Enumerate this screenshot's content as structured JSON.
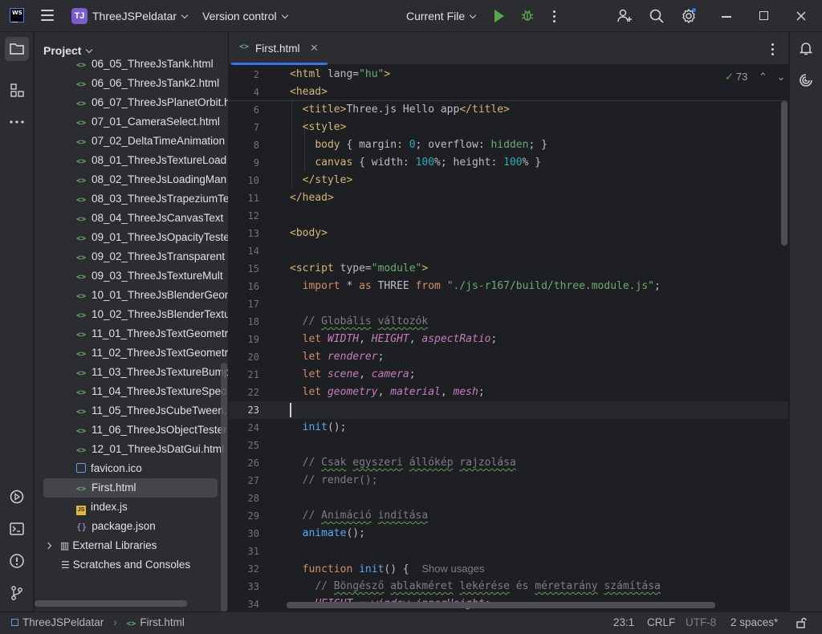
{
  "titlebar": {
    "project_badge": "TJ",
    "project_name": "ThreeJSPeldatar",
    "vcs_label": "Version control",
    "run_config": "Current File"
  },
  "project_panel": {
    "title": "Project",
    "items": [
      {
        "label": "06_05_ThreeJsTank.html",
        "type": "html"
      },
      {
        "label": "06_06_ThreeJsTank2.html",
        "type": "html"
      },
      {
        "label": "06_07_ThreeJsPlanetOrbit.h",
        "type": "html"
      },
      {
        "label": "07_01_CameraSelect.html",
        "type": "html"
      },
      {
        "label": "07_02_DeltaTimeAnimation",
        "type": "html"
      },
      {
        "label": "08_01_ThreeJsTextureLoad",
        "type": "html"
      },
      {
        "label": "08_02_ThreeJsLoadingMan",
        "type": "html"
      },
      {
        "label": "08_03_ThreeJsTrapeziumTe",
        "type": "html"
      },
      {
        "label": "08_04_ThreeJsCanvasText",
        "type": "html"
      },
      {
        "label": "09_01_ThreeJsOpacityTeste",
        "type": "html"
      },
      {
        "label": "09_02_ThreeJsTransparent",
        "type": "html"
      },
      {
        "label": "09_03_ThreeJsTextureMult",
        "type": "html"
      },
      {
        "label": "10_01_ThreeJsBlenderGeon",
        "type": "html"
      },
      {
        "label": "10_02_ThreeJsBlenderTextu",
        "type": "html"
      },
      {
        "label": "11_01_ThreeJsTextGeometr",
        "type": "html"
      },
      {
        "label": "11_02_ThreeJsTextGeometr",
        "type": "html"
      },
      {
        "label": "11_03_ThreeJsTextureBump",
        "type": "html"
      },
      {
        "label": "11_04_ThreeJsTextureSpec",
        "type": "html"
      },
      {
        "label": "11_05_ThreeJsCubeTween.",
        "type": "html"
      },
      {
        "label": "11_06_ThreeJsObjectTester",
        "type": "html"
      },
      {
        "label": "12_01_ThreeJsDatGui.html",
        "type": "html"
      },
      {
        "label": "favicon.ico",
        "type": "ico"
      },
      {
        "label": "First.html",
        "type": "html",
        "selected": true
      },
      {
        "label": "index.js",
        "type": "js"
      },
      {
        "label": "package.json",
        "type": "json"
      }
    ],
    "external_libraries": "External Libraries",
    "scratches": "Scratches and Consoles"
  },
  "editor": {
    "tab_label": "First.html",
    "inspection_count": "73",
    "show_usages": "Show usages"
  },
  "statusbar": {
    "breadcrumb_project": "ThreeJSPeldatar",
    "breadcrumb_file": "First.html",
    "position": "23:1",
    "line_ending": "CRLF",
    "encoding": "UTF-8",
    "indent": "2 spaces*"
  },
  "colors": {
    "accent": "#3574f0",
    "run_green": "#57a64a",
    "badge_purple": "#7a5bd0"
  }
}
